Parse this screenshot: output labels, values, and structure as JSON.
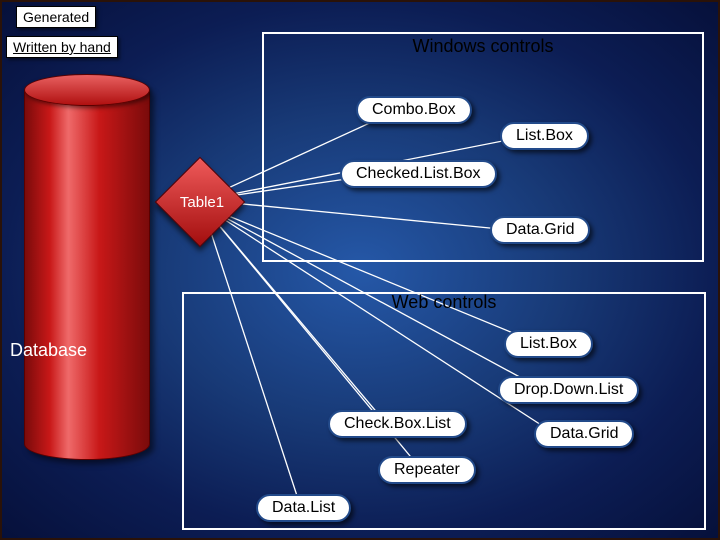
{
  "labels": {
    "generated": "Generated",
    "writtenByHand": "Written by hand"
  },
  "database": {
    "label": "Database",
    "table": "Table1"
  },
  "panels": {
    "windows": {
      "title": "Windows controls",
      "items": {
        "combo": "Combo.Box",
        "list": "List.Box",
        "checkedList": "Checked.List.Box",
        "dataGrid": "Data.Grid"
      }
    },
    "web": {
      "title": "Web controls",
      "items": {
        "list": "List.Box",
        "dropDown": "Drop.Down.List",
        "checkBoxList": "Check.Box.List",
        "dataGrid": "Data.Grid",
        "repeater": "Repeater",
        "dataList": "Data.List"
      }
    }
  }
}
